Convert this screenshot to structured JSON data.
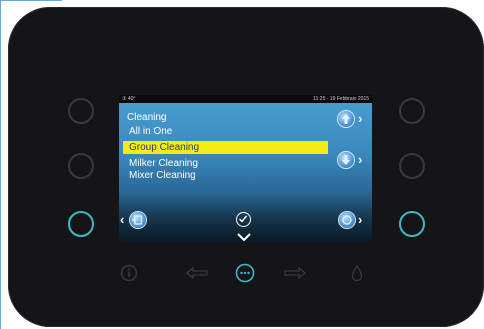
{
  "status": {
    "left": "③ 40°",
    "datetime": "11:25 · 19 Febbraio 2015"
  },
  "menu": {
    "title": "Cleaning",
    "items": [
      {
        "label": "All in One",
        "selected": false
      },
      {
        "label": "Group Cleaning",
        "selected": true
      },
      {
        "label": "Milker Cleaning",
        "selected": false
      },
      {
        "label": "Mixer Cleaning",
        "selected": false
      }
    ]
  },
  "colors": {
    "panel": "#151517",
    "highlight": "#f5ea12",
    "highlight_text": "#2f3a88",
    "active_ring": "#3fb9c7"
  },
  "icons": {
    "up": "arrow-up-icon",
    "down": "arrow-down-icon",
    "back": "document-back-icon",
    "confirm": "check-icon",
    "next": "circle-next-icon",
    "info": "info-icon",
    "left": "arrow-left-icon",
    "menu": "more-icon",
    "right": "arrow-right-icon",
    "water": "water-drop-icon"
  }
}
